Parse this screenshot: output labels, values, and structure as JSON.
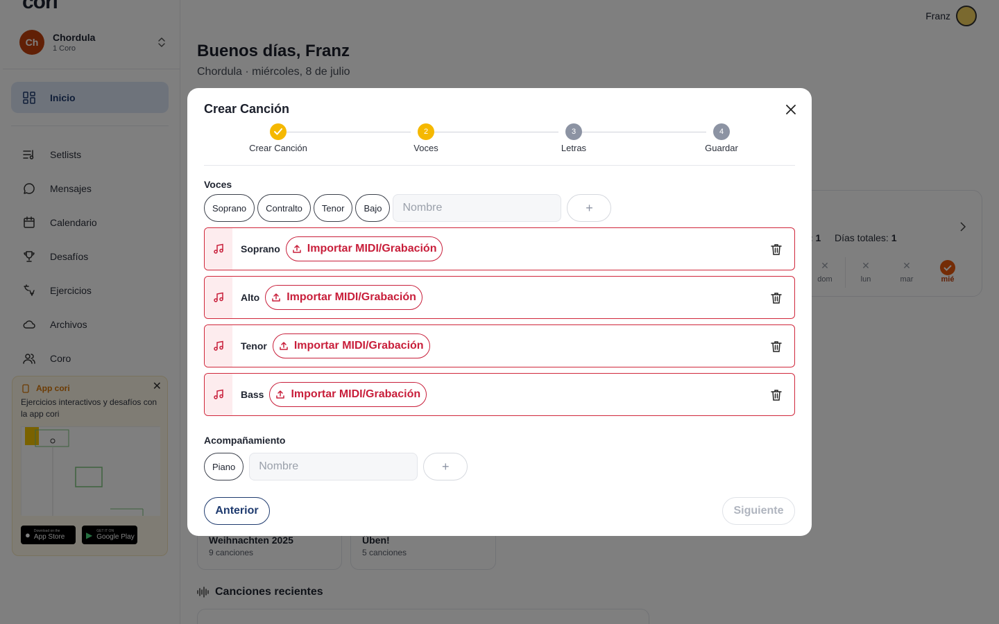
{
  "app": {
    "logo": "cori"
  },
  "sidebar": {
    "choir": {
      "initials": "Ch",
      "name": "Chordula",
      "subtitle": "1 Coro"
    },
    "active": {
      "label": "Inicio",
      "icon": "dashboard-icon"
    },
    "items": [
      {
        "label": "Setlists",
        "icon": "setlist-icon"
      },
      {
        "label": "Mensajes",
        "icon": "message-icon"
      },
      {
        "label": "Calendario",
        "icon": "calendar-icon"
      },
      {
        "label": "Desafíos",
        "icon": "trophy-icon"
      },
      {
        "label": "Ejercicios",
        "icon": "exercise-icon"
      },
      {
        "label": "Archivos",
        "icon": "cloud-icon"
      },
      {
        "label": "Coro",
        "icon": "users-icon"
      }
    ],
    "promo": {
      "title": "App cori",
      "text": "Ejercicios interactivos y desafíos con la app cori",
      "appstore_small": "Download on the",
      "appstore_big": "App Store",
      "googleplay_small": "GET IT ON",
      "googleplay_big": "Google Play"
    }
  },
  "header": {
    "user_name": "Franz"
  },
  "dashboard": {
    "greeting": "Buenos días, Franz",
    "subtitle": "Chordula · miércoles, 8 de julio",
    "streak": {
      "current_label_tail": ": 1",
      "total_label": "Días totales:",
      "total_value": "1",
      "days": [
        {
          "label": "dom",
          "done": false
        },
        {
          "label": "lun",
          "done": false
        },
        {
          "label": "mar",
          "done": false
        },
        {
          "label": "mié",
          "done": true
        }
      ]
    },
    "setlists": [
      {
        "name": "Weihnachten 2025",
        "count": "9 canciones"
      },
      {
        "name": "Üben!",
        "count": "5 canciones"
      }
    ],
    "recent_title": "Canciones recientes"
  },
  "modal": {
    "title": "Crear Canción",
    "steps": [
      {
        "number": "1",
        "label": "Crear Canción",
        "state": "done"
      },
      {
        "number": "2",
        "label": "Voces",
        "state": "current"
      },
      {
        "number": "3",
        "label": "Letras",
        "state": "todo"
      },
      {
        "number": "4",
        "label": "Guardar",
        "state": "todo"
      }
    ],
    "voices": {
      "title": "Voces",
      "chips": [
        "Soprano",
        "Contralto",
        "Tenor",
        "Bajo"
      ],
      "name_placeholder": "Nombre",
      "add_label": "+",
      "rows": [
        {
          "name": "Soprano",
          "import_label": "Importar MIDI/Grabación"
        },
        {
          "name": "Alto",
          "import_label": "Importar MIDI/Grabación"
        },
        {
          "name": "Tenor",
          "import_label": "Importar MIDI/Grabación"
        },
        {
          "name": "Bass",
          "import_label": "Importar MIDI/Grabación"
        }
      ]
    },
    "accompaniment": {
      "title": "Acompañamiento",
      "chips": [
        "Piano"
      ],
      "name_placeholder": "Nombre",
      "add_label": "+"
    },
    "prev_label": "Anterior",
    "next_label": "Siguiente"
  },
  "colors": {
    "accent_red": "#c81e3a",
    "step_yellow": "#f5b800",
    "nav_active_bg": "#dde6f6",
    "primary_navy": "#1e3a6e"
  }
}
